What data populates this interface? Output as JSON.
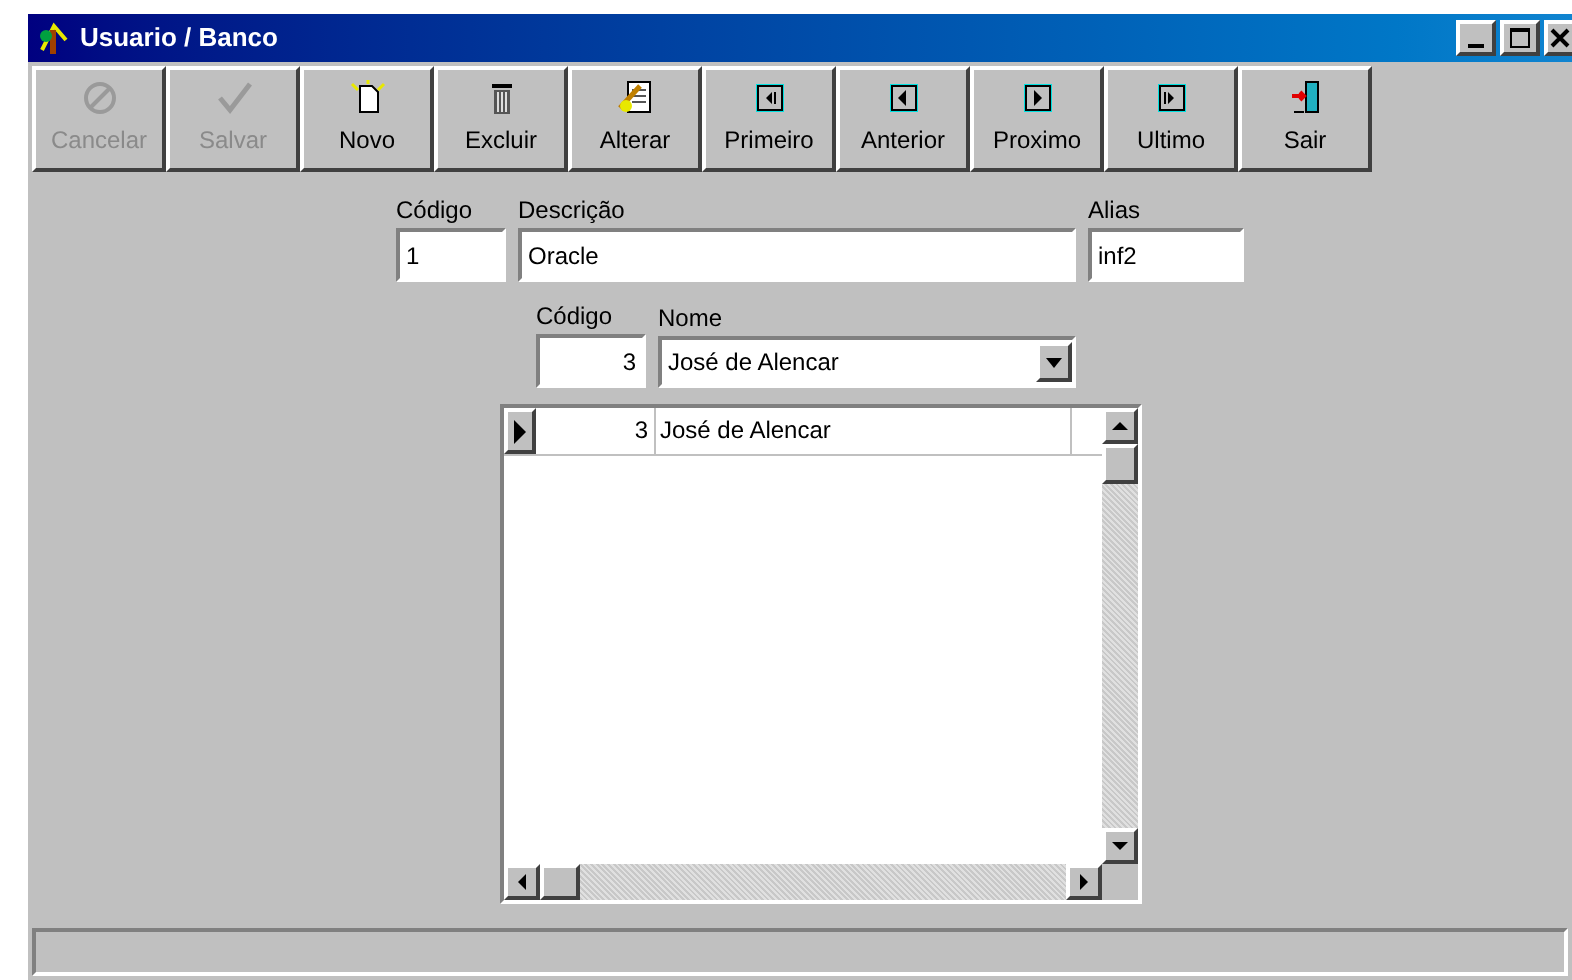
{
  "window": {
    "title": "Usuario / Banco"
  },
  "toolbar": [
    {
      "label": "Cancelar",
      "disabled": true
    },
    {
      "label": "Salvar",
      "disabled": true
    },
    {
      "label": "Novo",
      "disabled": false
    },
    {
      "label": "Excluir",
      "disabled": false
    },
    {
      "label": "Alterar",
      "disabled": false
    },
    {
      "label": "Primeiro",
      "disabled": false
    },
    {
      "label": "Anterior",
      "disabled": false
    },
    {
      "label": "Proximo",
      "disabled": false
    },
    {
      "label": "Ultimo",
      "disabled": false
    },
    {
      "label": "Sair",
      "disabled": false
    }
  ],
  "form": {
    "codigo": {
      "label": "Código",
      "value": "1"
    },
    "descricao": {
      "label": "Descrição",
      "value": "Oracle"
    },
    "alias": {
      "label": "Alias",
      "value": "inf2"
    },
    "usuario_codigo": {
      "label": "Código",
      "value": "3"
    },
    "nome": {
      "label": "Nome",
      "value": "José de Alencar"
    }
  },
  "grid": {
    "rows": [
      {
        "selected": true,
        "column_1": "3",
        "column_2": "José de Alencar"
      }
    ]
  }
}
